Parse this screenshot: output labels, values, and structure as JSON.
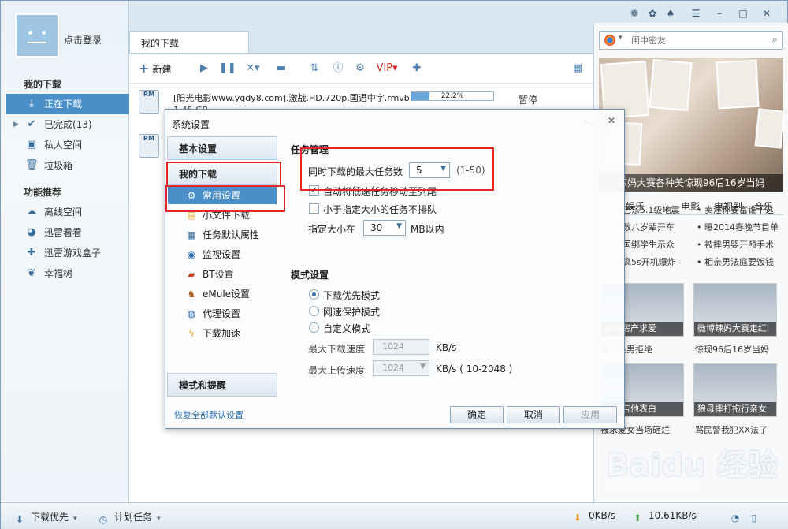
{
  "user": {
    "login": "点击登录"
  },
  "sidebar": {
    "section1": "我的下载",
    "items": [
      {
        "label": "正在下载",
        "icon": "download-icon"
      },
      {
        "label": "已完成(13)",
        "icon": "check-icon"
      },
      {
        "label": "私人空间",
        "icon": "lock-icon"
      },
      {
        "label": "垃圾箱",
        "icon": "trash-icon"
      }
    ],
    "section2": "功能推荐",
    "features": [
      {
        "label": "离线空间",
        "icon": "cloud-icon"
      },
      {
        "label": "迅雷看看",
        "icon": "kankan-icon"
      },
      {
        "label": "迅雷游戏盒子",
        "icon": "gamepad-icon"
      },
      {
        "label": "幸福树",
        "icon": "leaf-icon"
      }
    ]
  },
  "main_tab": "我的下载",
  "toolbar": {
    "new_label": "新建"
  },
  "tasks": [
    {
      "name": "[阳光电影www.ygdy8.com].激战.HD.720p.国语中字.rmvb",
      "size": "1.45 GB",
      "progress_text": "22.2%",
      "progress": 0.222,
      "status": "暂停",
      "type_badge": "RM"
    },
    {
      "name": "",
      "size": "",
      "type_badge": "RM"
    }
  ],
  "right": {
    "search_placeholder": "闺中密友",
    "banner_caption": "辣妈大赛各种美惊现96后16岁当妈",
    "tabs": [
      "娱乐",
      "电影",
      "电视剧",
      "音乐"
    ],
    "news_left": [
      "巴东5.1级地震",
      "数八岁辈开车",
      "国绑学生示众",
      "疯5s开机爆炸"
    ],
    "news_right": [
      "• 卖淫称要富谁干这",
      "• 曝2014春晚节目单",
      "• 被摔男婴开颅手术",
      "• 相亲男法庭要饭钱"
    ],
    "thumbs": [
      {
        "caption": "女携房产求爱",
        "sub": "戏公会男拒绝"
      },
      {
        "caption": "微博辣妈大赛走红",
        "sub": "惊现96后16岁当妈"
      },
      {
        "caption": "大学吉他表白",
        "sub": "被求爱女当场砸烂"
      },
      {
        "caption": "狼母摔打拖行亲女",
        "sub": "骂民警我犯XX法了"
      }
    ]
  },
  "watermark": {
    "main": "Baidu 经验",
    "sub": "jingyan.baidu.com"
  },
  "bottom": {
    "mode": "下载优先",
    "schedule": "计划任务",
    "down_speed": "0KB/s",
    "up_speed": "10.61KB/s"
  },
  "dialog": {
    "title": "系统设置",
    "nav": {
      "basic": "基本设置",
      "mydownload": "我的下载",
      "items": [
        {
          "label": "常用设置",
          "icon": "gear-icon",
          "selected": true
        },
        {
          "label": "小文件下载",
          "icon": "small-file-icon"
        },
        {
          "label": "任务默认属性",
          "icon": "properties-icon"
        },
        {
          "label": "监视设置",
          "icon": "monitor-icon"
        },
        {
          "label": "BT设置",
          "icon": "bt-icon"
        },
        {
          "label": "eMule设置",
          "icon": "emule-icon"
        },
        {
          "label": "代理设置",
          "icon": "proxy-icon"
        },
        {
          "label": "下载加速",
          "icon": "lightning-icon"
        }
      ],
      "mode_reminder": "模式和提醒"
    },
    "restore_label": "恢复全部默认设置",
    "task_group": {
      "title": "任务管理",
      "max_tasks_label": "同时下载的最大任务数",
      "max_tasks_value": "5",
      "max_tasks_range": "(1-50)",
      "auto_move_label": "自动将低速任务移动至列尾",
      "auto_move_checked": true,
      "small_task_label": "小于指定大小的任务不排队",
      "small_task_checked": false,
      "size_label": "指定大小在",
      "size_value": "30",
      "size_unit": "MB以内"
    },
    "mode_group": {
      "title": "模式设置",
      "options": [
        "下载优先模式",
        "网速保护模式",
        "自定义模式"
      ],
      "selected": 0,
      "max_down_label": "最大下载速度",
      "max_down_value": "1024",
      "max_down_unit": "KB/s",
      "max_up_label": "最大上传速度",
      "max_up_value": "1024",
      "max_up_unit": "KB/s ( 10-2048 )"
    },
    "buttons": {
      "ok": "确定",
      "cancel": "取消",
      "apply": "应用"
    }
  }
}
